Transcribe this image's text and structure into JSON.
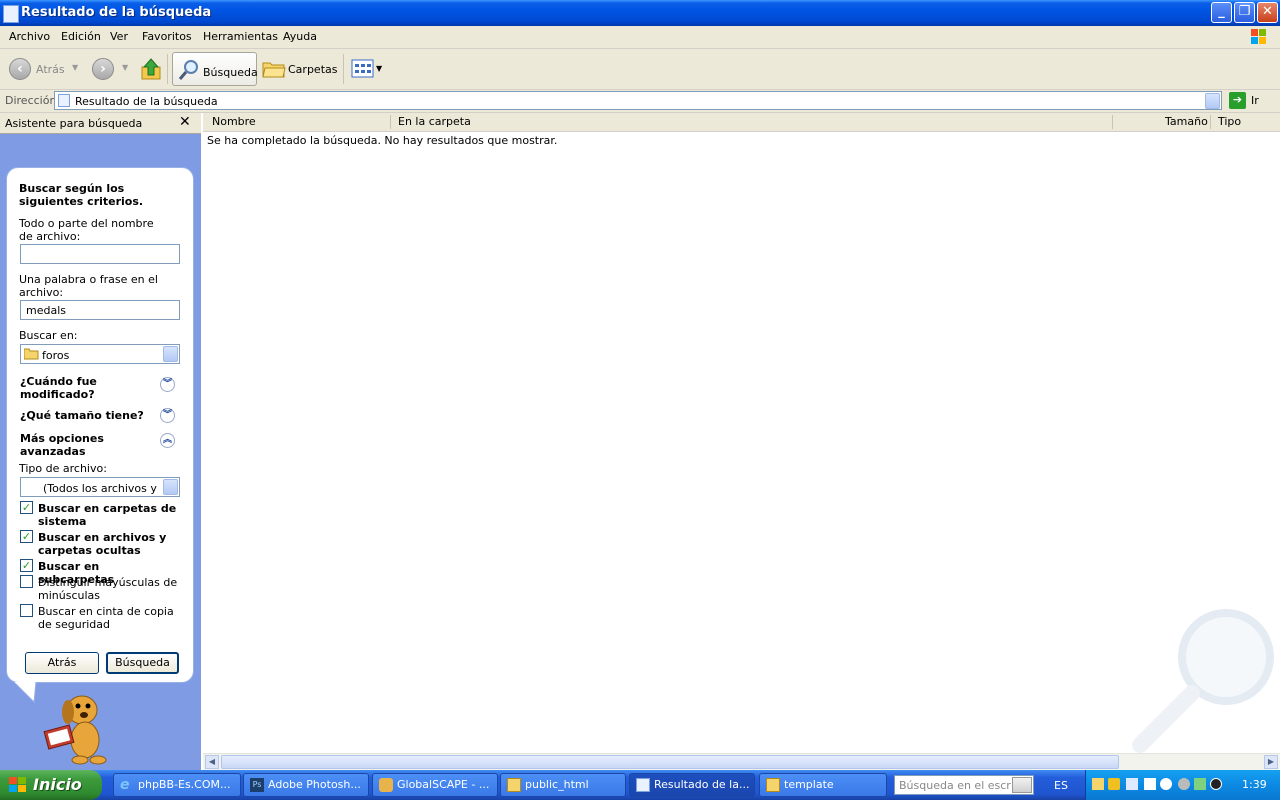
{
  "window": {
    "title": "Resultado de la búsqueda"
  },
  "menu": [
    "Archivo",
    "Edición",
    "Ver",
    "Favoritos",
    "Herramientas",
    "Ayuda"
  ],
  "toolbar": {
    "back_label": "Atrás",
    "search_label": "Búsqueda",
    "folders_label": "Carpetas"
  },
  "address": {
    "label": "Dirección",
    "value": "Resultado de la búsqueda",
    "go_label": "Ir"
  },
  "search_pane": {
    "header": "Asistente para búsqueda",
    "title": "Buscar según los siguientes criterios.",
    "filename_label": "Todo o parte del nombre de archivo:",
    "filename_value": "",
    "phrase_label": "Una palabra o frase en el archivo:",
    "phrase_value": "medals",
    "look_in_label": "Buscar en:",
    "look_in_value": "foros",
    "when_modified": "¿Cuándo fue modificado?",
    "what_size": "¿Qué tamaño tiene?",
    "advanced": "Más opciones avanzadas",
    "file_type_label": "Tipo de archivo:",
    "file_type_value": "(Todos los archivos y car",
    "options": [
      {
        "label": "Buscar en carpetas de sistema",
        "checked": true
      },
      {
        "label": "Buscar en archivos y carpetas ocultas",
        "checked": true
      },
      {
        "label": "Buscar en subcarpetas",
        "checked": true
      },
      {
        "label": "Distinguir mayúsculas de minúsculas",
        "checked": false
      },
      {
        "label": "Buscar en cinta de copia de seguridad",
        "checked": false
      }
    ],
    "back_button": "Atrás",
    "search_button": "Búsqueda"
  },
  "results": {
    "columns": [
      "Nombre",
      "En la carpeta",
      "Tamaño",
      "Tipo"
    ],
    "message": "Se ha completado la búsqueda. No hay resultados que mostrar."
  },
  "taskbar": {
    "start_label": "Inicio",
    "tasks": [
      "phpBB-Es.COM...",
      "Adobe Photosh...",
      "GlobalSCAPE - ...",
      "public_html",
      "Resultado de la...",
      "template"
    ],
    "desktop_search_placeholder": "Búsqueda en el escritorio",
    "language": "ES",
    "clock": "1:39"
  }
}
